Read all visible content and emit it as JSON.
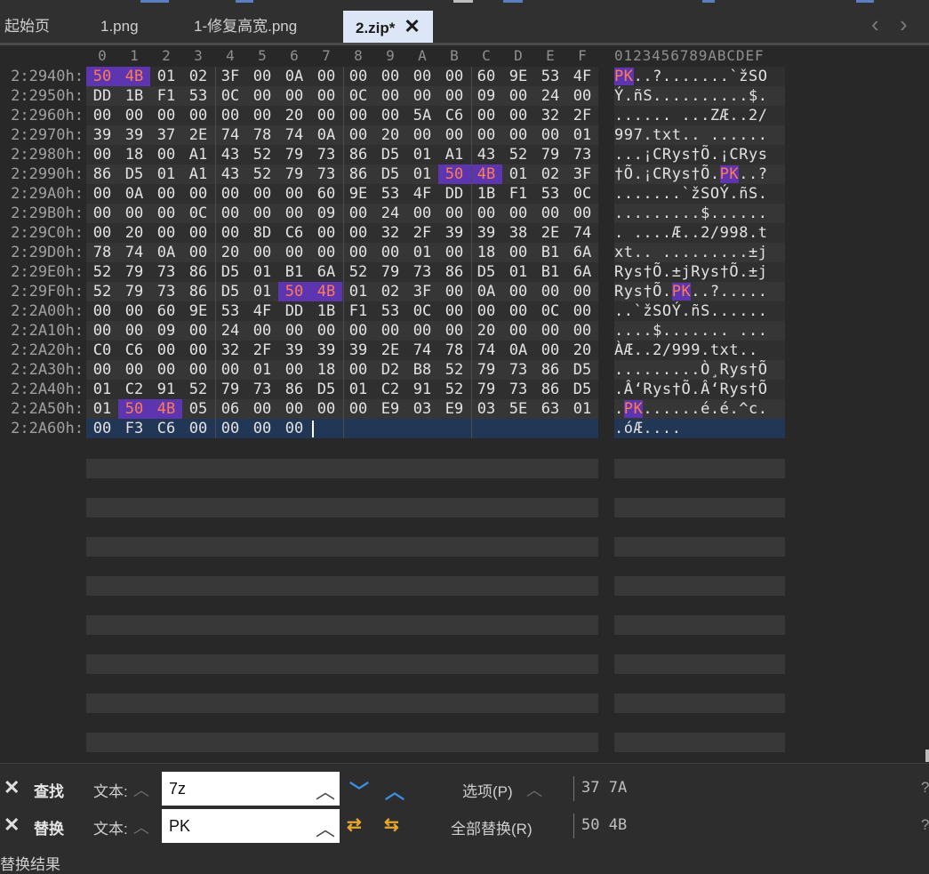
{
  "tabs": [
    {
      "label": "起始页",
      "active": false
    },
    {
      "label": "1.png",
      "active": false
    },
    {
      "label": "1-修复高宽.png",
      "active": false
    },
    {
      "label": "2.zip*",
      "active": true
    }
  ],
  "hex_view": {
    "column_headers": [
      "0",
      "1",
      "2",
      "3",
      "4",
      "5",
      "6",
      "7",
      "8",
      "9",
      "A",
      "B",
      "C",
      "D",
      "E",
      "F"
    ],
    "ascii_header": "0123456789ABCDEF",
    "rows": [
      {
        "addr": "2:2940h:",
        "bytes": [
          "50",
          "4B",
          "01",
          "02",
          "3F",
          "00",
          "0A",
          "00",
          "00",
          "00",
          "00",
          "00",
          "60",
          "9E",
          "53",
          "4F"
        ],
        "hl": [
          0,
          1
        ],
        "ascii": [
          {
            "t": "PK",
            "h": true
          },
          {
            "t": "..?.......`žSO"
          }
        ]
      },
      {
        "addr": "2:2950h:",
        "bytes": [
          "DD",
          "1B",
          "F1",
          "53",
          "0C",
          "00",
          "00",
          "00",
          "0C",
          "00",
          "00",
          "00",
          "09",
          "00",
          "24",
          "00"
        ],
        "hl": [],
        "ascii": [
          {
            "t": "Ý.ñS..........$."
          }
        ]
      },
      {
        "addr": "2:2960h:",
        "bytes": [
          "00",
          "00",
          "00",
          "00",
          "00",
          "00",
          "20",
          "00",
          "00",
          "00",
          "5A",
          "C6",
          "00",
          "00",
          "32",
          "2F"
        ],
        "hl": [],
        "ascii": [
          {
            "t": "...... ...ZÆ..2/"
          }
        ]
      },
      {
        "addr": "2:2970h:",
        "bytes": [
          "39",
          "39",
          "37",
          "2E",
          "74",
          "78",
          "74",
          "0A",
          "00",
          "20",
          "00",
          "00",
          "00",
          "00",
          "00",
          "01"
        ],
        "hl": [],
        "ascii": [
          {
            "t": "997.txt.. ......"
          }
        ]
      },
      {
        "addr": "2:2980h:",
        "bytes": [
          "00",
          "18",
          "00",
          "A1",
          "43",
          "52",
          "79",
          "73",
          "86",
          "D5",
          "01",
          "A1",
          "43",
          "52",
          "79",
          "73"
        ],
        "hl": [],
        "ascii": [
          {
            "t": "...¡CRys†Õ.¡CRys"
          }
        ]
      },
      {
        "addr": "2:2990h:",
        "bytes": [
          "86",
          "D5",
          "01",
          "A1",
          "43",
          "52",
          "79",
          "73",
          "86",
          "D5",
          "01",
          "50",
          "4B",
          "01",
          "02",
          "3F"
        ],
        "hl": [
          11,
          12
        ],
        "ascii": [
          {
            "t": "†Õ.¡CRys†Õ."
          },
          {
            "t": "PK",
            "h": true
          },
          {
            "t": "..?"
          }
        ]
      },
      {
        "addr": "2:29A0h:",
        "bytes": [
          "00",
          "0A",
          "00",
          "00",
          "00",
          "00",
          "00",
          "60",
          "9E",
          "53",
          "4F",
          "DD",
          "1B",
          "F1",
          "53",
          "0C"
        ],
        "hl": [],
        "ascii": [
          {
            "t": ".......`žSOÝ.ñS."
          }
        ]
      },
      {
        "addr": "2:29B0h:",
        "bytes": [
          "00",
          "00",
          "00",
          "0C",
          "00",
          "00",
          "00",
          "09",
          "00",
          "24",
          "00",
          "00",
          "00",
          "00",
          "00",
          "00"
        ],
        "hl": [],
        "ascii": [
          {
            "t": ".........$......"
          }
        ]
      },
      {
        "addr": "2:29C0h:",
        "bytes": [
          "00",
          "20",
          "00",
          "00",
          "00",
          "8D",
          "C6",
          "00",
          "00",
          "32",
          "2F",
          "39",
          "39",
          "38",
          "2E",
          "74"
        ],
        "hl": [],
        "ascii": [
          {
            "t": ". ....Æ..2/998.t"
          }
        ]
      },
      {
        "addr": "2:29D0h:",
        "bytes": [
          "78",
          "74",
          "0A",
          "00",
          "20",
          "00",
          "00",
          "00",
          "00",
          "00",
          "01",
          "00",
          "18",
          "00",
          "B1",
          "6A"
        ],
        "hl": [],
        "ascii": [
          {
            "t": "xt.. .........±j"
          }
        ]
      },
      {
        "addr": "2:29E0h:",
        "bytes": [
          "52",
          "79",
          "73",
          "86",
          "D5",
          "01",
          "B1",
          "6A",
          "52",
          "79",
          "73",
          "86",
          "D5",
          "01",
          "B1",
          "6A"
        ],
        "hl": [],
        "ascii": [
          {
            "t": "Rys†Õ.±jRys†Õ.±j"
          }
        ]
      },
      {
        "addr": "2:29F0h:",
        "bytes": [
          "52",
          "79",
          "73",
          "86",
          "D5",
          "01",
          "50",
          "4B",
          "01",
          "02",
          "3F",
          "00",
          "0A",
          "00",
          "00",
          "00"
        ],
        "hl": [
          6,
          7
        ],
        "ascii": [
          {
            "t": "Rys†Õ."
          },
          {
            "t": "PK",
            "h": true
          },
          {
            "t": "..?....."
          }
        ]
      },
      {
        "addr": "2:2A00h:",
        "bytes": [
          "00",
          "00",
          "60",
          "9E",
          "53",
          "4F",
          "DD",
          "1B",
          "F1",
          "53",
          "0C",
          "00",
          "00",
          "00",
          "0C",
          "00"
        ],
        "hl": [],
        "ascii": [
          {
            "t": "..`žSOÝ.ñS......"
          }
        ]
      },
      {
        "addr": "2:2A10h:",
        "bytes": [
          "00",
          "00",
          "09",
          "00",
          "24",
          "00",
          "00",
          "00",
          "00",
          "00",
          "00",
          "00",
          "20",
          "00",
          "00",
          "00"
        ],
        "hl": [],
        "ascii": [
          {
            "t": "....$....... ..."
          }
        ]
      },
      {
        "addr": "2:2A20h:",
        "bytes": [
          "C0",
          "C6",
          "00",
          "00",
          "32",
          "2F",
          "39",
          "39",
          "39",
          "2E",
          "74",
          "78",
          "74",
          "0A",
          "00",
          "20"
        ],
        "hl": [],
        "ascii": [
          {
            "t": "ÀÆ..2/999.txt.. "
          }
        ]
      },
      {
        "addr": "2:2A30h:",
        "bytes": [
          "00",
          "00",
          "00",
          "00",
          "00",
          "01",
          "00",
          "18",
          "00",
          "D2",
          "B8",
          "52",
          "79",
          "73",
          "86",
          "D5"
        ],
        "hl": [],
        "ascii": [
          {
            "t": ".........Ò¸Rys†Õ"
          }
        ]
      },
      {
        "addr": "2:2A40h:",
        "bytes": [
          "01",
          "C2",
          "91",
          "52",
          "79",
          "73",
          "86",
          "D5",
          "01",
          "C2",
          "91",
          "52",
          "79",
          "73",
          "86",
          "D5"
        ],
        "hl": [],
        "ascii": [
          {
            "t": ".Â‘Rys†Õ.Â‘Rys†Õ"
          }
        ]
      },
      {
        "addr": "2:2A50h:",
        "bytes": [
          "01",
          "50",
          "4B",
          "05",
          "06",
          "00",
          "00",
          "00",
          "00",
          "E9",
          "03",
          "E9",
          "03",
          "5E",
          "63",
          "01"
        ],
        "hl": [
          1,
          2
        ],
        "ascii": [
          {
            "t": "."
          },
          {
            "t": "PK",
            "h": true
          },
          {
            "t": "......é.é.^c."
          }
        ]
      },
      {
        "addr": "2:2A60h:",
        "bytes": [
          "00",
          "F3",
          "C6",
          "00",
          "00",
          "00",
          "00"
        ],
        "hl": [],
        "ascii": [
          {
            "t": ".óÆ...."
          }
        ]
      }
    ]
  },
  "find": {
    "label": "查找",
    "kind": "文本:",
    "value": "7z",
    "options_label": "选项(P)",
    "hex_value": "37 7A"
  },
  "replace": {
    "label": "替换",
    "kind": "文本:",
    "value": "PK",
    "replace_all_label": "全部替换(R)",
    "hex_value": "50 4B"
  },
  "results_label": "替换结果"
}
